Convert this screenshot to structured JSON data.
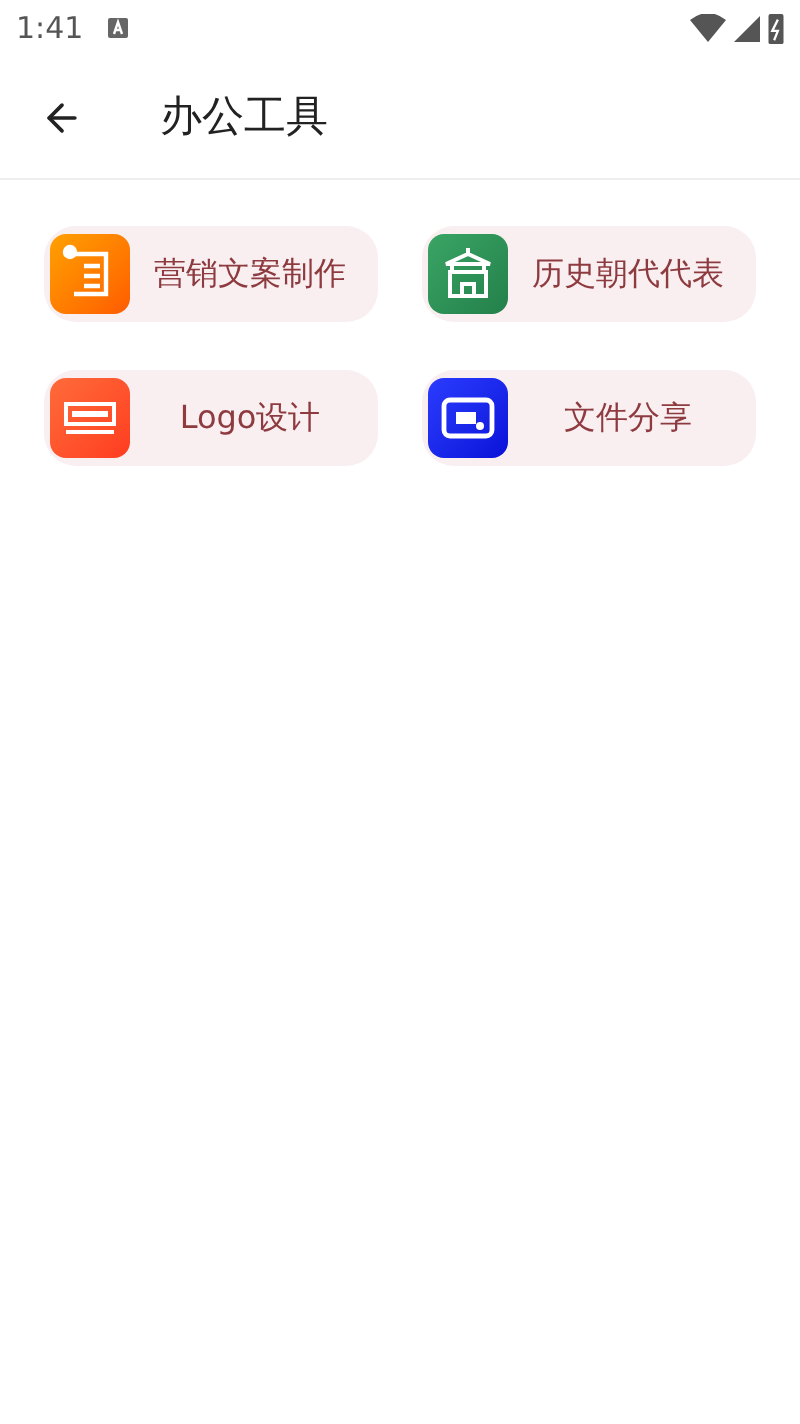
{
  "status_bar": {
    "time": "1:41"
  },
  "app_bar": {
    "title": "办公工具"
  },
  "tools": [
    {
      "label": "营销文案制作",
      "kind": "document"
    },
    {
      "label": "历史朝代代表",
      "kind": "palace"
    },
    {
      "label": "Logo设计",
      "kind": "logo"
    },
    {
      "label": "文件分享",
      "kind": "share"
    }
  ]
}
